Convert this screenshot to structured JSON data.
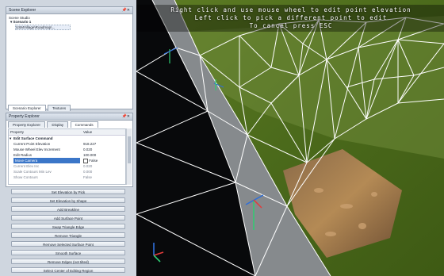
{
  "app": {
    "scene_explorer": {
      "title": "Scene Explorer",
      "tree_header": "Scene Studio",
      "scenario": "Scenario 1",
      "child": "USMVillage\\Roadmap\\...",
      "tabs": [
        "Scenario Explorer",
        "Textures"
      ]
    },
    "property_explorer": {
      "title": "Property Explorer",
      "tabs": [
        "Property Explorer",
        "Display",
        "Commands"
      ],
      "columns": [
        "Property",
        "Value"
      ],
      "section": "Edit Surface Command",
      "rows": [
        {
          "name": "Current Point Elevation",
          "value": "918.227"
        },
        {
          "name": "Mouse Wheel Elev Increment",
          "value": "0.020"
        },
        {
          "name": "Edit Radius",
          "value": "100.000"
        },
        {
          "name": "Move Camera",
          "value": "False"
        },
        {
          "name": "Current Elev Inc",
          "value": "0.020"
        },
        {
          "name": "Scale Contours Min Lev",
          "value": "0.000"
        },
        {
          "name": "Show Contours",
          "value": "False"
        }
      ],
      "checkbox_label": "False"
    },
    "commands": [
      "Set Elevation by Pick",
      "Set Elevation by Shape",
      "Add Breakline",
      "Add Surface Point",
      "Swap Triangle Edge",
      "Remove Triangle",
      "Remove Selected Surface Point",
      "Smooth Surface",
      "Remove Edges (not tilted)",
      "Select Center of Editing Region"
    ],
    "viewport": {
      "instructions": [
        "Right click and use mouse wheel to edit point elevation",
        "Left click to pick a different point to edit",
        "To cancel press ESC"
      ]
    },
    "colors": {
      "grass": "#4f6d1e",
      "road": "#868a8d",
      "asphalt": "#08090b",
      "wire": "#ffffff",
      "selection": "#3b76c8"
    }
  }
}
